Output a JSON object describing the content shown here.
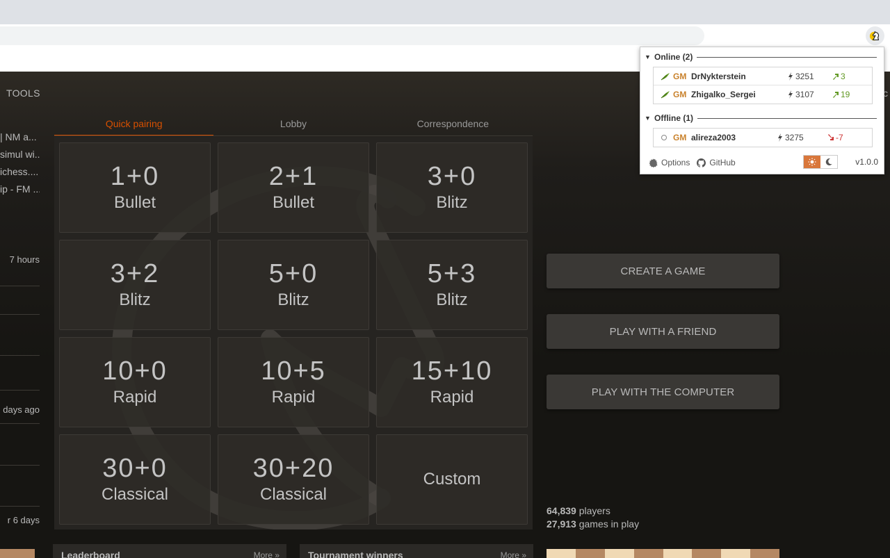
{
  "site_nav": {
    "tools": "TOOLS"
  },
  "side": {
    "links": [
      "| NM a...",
      "simul wi...",
      "ichess....",
      "ip - FM ..."
    ],
    "rows": [
      "7 hours",
      "days ago",
      "r 6 days"
    ]
  },
  "lobby": {
    "tabs": [
      "Quick pairing",
      "Lobby",
      "Correspondence"
    ],
    "active_tab": "Quick pairing",
    "pools": [
      {
        "clock": "1+0",
        "perf": "Bullet"
      },
      {
        "clock": "2+1",
        "perf": "Bullet"
      },
      {
        "clock": "3+0",
        "perf": "Blitz"
      },
      {
        "clock": "3+2",
        "perf": "Blitz"
      },
      {
        "clock": "5+0",
        "perf": "Blitz"
      },
      {
        "clock": "5+3",
        "perf": "Blitz"
      },
      {
        "clock": "10+0",
        "perf": "Rapid"
      },
      {
        "clock": "10+5",
        "perf": "Rapid"
      },
      {
        "clock": "15+10",
        "perf": "Rapid"
      },
      {
        "clock": "30+0",
        "perf": "Classical"
      },
      {
        "clock": "30+20",
        "perf": "Classical"
      }
    ],
    "custom_label": "Custom"
  },
  "actions": {
    "create_game": "CREATE A GAME",
    "play_friend": "PLAY WITH A FRIEND",
    "play_computer": "PLAY WITH THE COMPUTER"
  },
  "counters": {
    "players_count": "64,839",
    "players_label": " players",
    "games_count": "27,913",
    "games_label": " games in play"
  },
  "bottom": {
    "leaderboard": "Leaderboard",
    "leaderboard_more": "More »",
    "tournament_winners": "Tournament winners",
    "tournament_more": "More »"
  },
  "popup": {
    "online_header": "Online (2)",
    "offline_header": "Offline (1)",
    "online": [
      {
        "title": "GM",
        "name": "DrNykterstein",
        "rating": "3251",
        "diff": "3",
        "direction": "up"
      },
      {
        "title": "GM",
        "name": "Zhigalko_Sergei",
        "rating": "3107",
        "diff": "19",
        "direction": "up"
      }
    ],
    "offline": [
      {
        "title": "GM",
        "name": "alireza2003",
        "rating": "3275",
        "diff": "-7",
        "direction": "down"
      }
    ],
    "options_label": "Options",
    "github_label": "GitHub",
    "version": "v1.0.0"
  },
  "colors": {
    "accent": "#d85000",
    "title_gold": "#c9822c",
    "up_green": "#629924",
    "down_red": "#cc3333",
    "theme_active": "#d9773b"
  }
}
